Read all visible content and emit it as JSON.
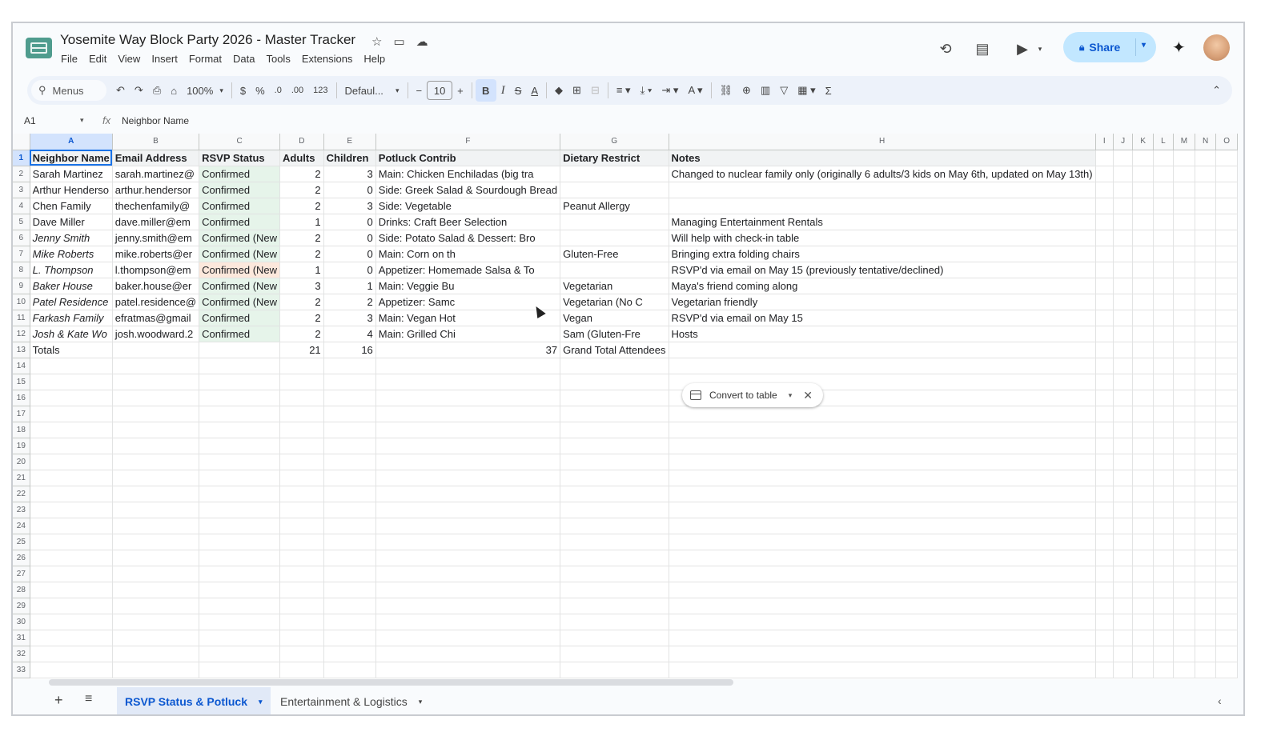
{
  "app": {
    "doc_title": "Yosemite Way Block Party 2026 - Master Tracker",
    "menu": [
      "File",
      "Edit",
      "View",
      "Insert",
      "Format",
      "Data",
      "Tools",
      "Extensions",
      "Help"
    ],
    "share_label": "Share"
  },
  "toolbar": {
    "search_label": "Menus",
    "zoom": "100%",
    "currency": "$",
    "percent": "%",
    "dec_less": ".0",
    "dec_more": ".00",
    "number_format": "123",
    "font": "Defaul...",
    "font_size": "10",
    "bold": "B",
    "italic": "I"
  },
  "formula_bar": {
    "cell_ref": "A1",
    "fx": "fx",
    "value": "Neighbor Name"
  },
  "sheet": {
    "columns": [
      "A",
      "B",
      "C",
      "D",
      "E",
      "F",
      "G",
      "H",
      "I",
      "J",
      "K",
      "L",
      "M",
      "N",
      "O"
    ],
    "headers": [
      "Neighbor Name",
      "Email Address",
      "RSVP Status",
      "Adults",
      "Children",
      "Potluck Contrib",
      "Dietary Restrict",
      "Notes"
    ],
    "rows": [
      {
        "name": "Sarah Martinez",
        "email": "sarah.martinez@",
        "rsvp": "Confirmed",
        "adults": "2",
        "children": "3",
        "potluck": "Main: Chicken Enchiladas (big tra",
        "diet": "",
        "notes": "Changed to nuclear family only (originally 6 adults/3 kids on May 6th, updated on May 13th)"
      },
      {
        "name": "Arthur Henderso",
        "email": "arthur.hendersor",
        "rsvp": "Confirmed",
        "adults": "2",
        "children": "0",
        "potluck": "Side: Greek Salad & Sourdough Bread",
        "diet": "",
        "notes": ""
      },
      {
        "name": "Chen Family",
        "email": "thechenfamily@",
        "rsvp": "Confirmed",
        "adults": "2",
        "children": "3",
        "potluck": "Side: Vegetable",
        "diet": "Peanut Allergy",
        "notes": ""
      },
      {
        "name": "Dave Miller",
        "email": "dave.miller@em",
        "rsvp": "Confirmed",
        "adults": "1",
        "children": "0",
        "potluck": "Drinks: Craft Beer Selection",
        "diet": "",
        "notes": "Managing Entertainment Rentals"
      },
      {
        "name": "Jenny Smith",
        "email": "jenny.smith@em",
        "rsvp": "Confirmed (New",
        "adults": "2",
        "children": "0",
        "potluck": "Side: Potato Salad & Dessert: Bro",
        "diet": "",
        "notes": "Will help with check-in table"
      },
      {
        "name": "Mike Roberts",
        "email": "mike.roberts@er",
        "rsvp": "Confirmed (New",
        "adults": "2",
        "children": "0",
        "potluck": "Main: Corn on th",
        "diet": "Gluten-Free",
        "notes": "Bringing extra folding chairs"
      },
      {
        "name": "L. Thompson",
        "email": "l.thompson@em",
        "rsvp": "Confirmed (New",
        "adults": "1",
        "children": "0",
        "potluck": "Appetizer: Homemade Salsa & To",
        "diet": "",
        "notes": "RSVP'd via email on May 15 (previously tentative/declined)"
      },
      {
        "name": "Baker House",
        "email": "baker.house@er",
        "rsvp": "Confirmed (New",
        "adults": "3",
        "children": "1",
        "potluck": "Main: Veggie Bu",
        "diet": "Vegetarian",
        "notes": "Maya's friend coming along"
      },
      {
        "name": "Patel Residence",
        "email": "patel.residence@",
        "rsvp": "Confirmed (New",
        "adults": "2",
        "children": "2",
        "potluck": "Appetizer: Samc",
        "diet": "Vegetarian (No C",
        "notes": "Vegetarian friendly"
      },
      {
        "name": "Farkash Family",
        "email": "efratmas@gmail",
        "rsvp": "Confirmed",
        "adults": "2",
        "children": "3",
        "potluck": "Main: Vegan Hot",
        "diet": "Vegan",
        "notes": "RSVP'd via email on May 15"
      },
      {
        "name": "Josh & Kate Wo",
        "email": "josh.woodward.2",
        "rsvp": "Confirmed",
        "adults": "2",
        "children": "4",
        "potluck": "Main: Grilled Chi",
        "diet": "Sam (Gluten-Fre",
        "notes": "Hosts"
      }
    ],
    "totals": {
      "label": "Totals",
      "adults": "21",
      "children": "16",
      "grand": "37",
      "grand_label": "Grand Total Attendees"
    },
    "row_numbers": [
      "1",
      "2",
      "3",
      "4",
      "5",
      "6",
      "7",
      "8",
      "9",
      "10",
      "11",
      "12",
      "13",
      "14",
      "15",
      "16",
      "17",
      "18",
      "19",
      "20",
      "21",
      "22",
      "23",
      "24",
      "25",
      "26",
      "27",
      "28",
      "29",
      "30",
      "31",
      "32",
      "33"
    ]
  },
  "convert_chip": {
    "label": "Convert to table"
  },
  "tabs": [
    "RSVP Status & Potluck",
    "Entertainment & Logistics"
  ],
  "colors": {
    "accent": "#0b57d0",
    "share_bg": "#c2e7ff",
    "confirmed_bg": "#e6f4ea",
    "thompson_rsvp_bg": "#fce8dc",
    "selection": "#1a73e8"
  },
  "icons": [
    "star-icon",
    "move-folder-icon",
    "cloud-icon",
    "history-icon",
    "comment-icon",
    "video-icon",
    "lock-icon",
    "gemini-spark-icon",
    "undo-icon",
    "redo-icon",
    "print-icon",
    "paint-format-icon",
    "borders-icon",
    "link-icon",
    "filter-icon",
    "function-icon",
    "table-icon",
    "close-icon"
  ]
}
